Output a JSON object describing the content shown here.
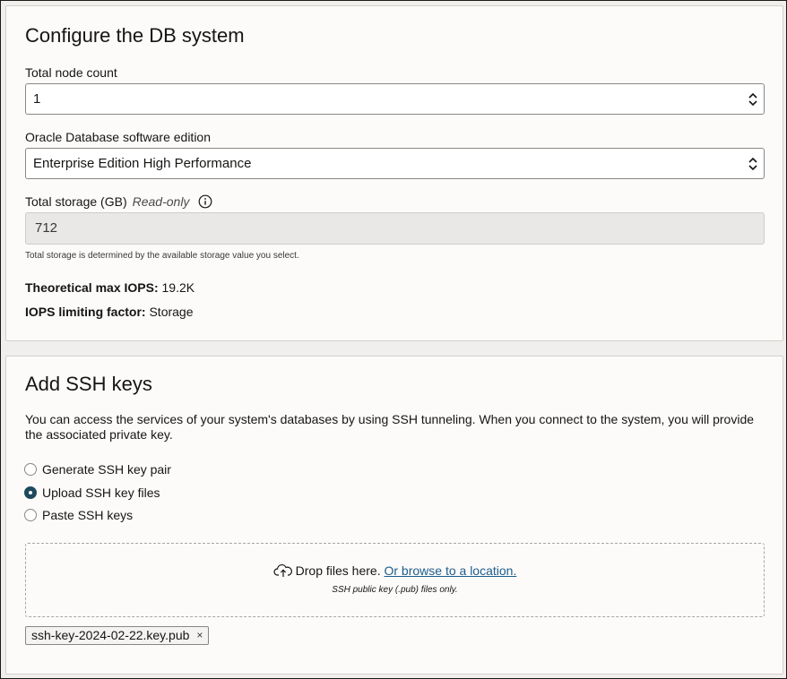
{
  "db_system": {
    "title": "Configure the DB system",
    "node_count": {
      "label": "Total node count",
      "value": "1"
    },
    "software_edition": {
      "label": "Oracle Database software edition",
      "value": "Enterprise Edition High Performance"
    },
    "storage": {
      "label": "Total storage (GB)",
      "readonly_tag": "Read-only",
      "value": "712",
      "help": "Total storage is determined by the available storage value you select."
    },
    "max_iops": {
      "label": "Theoretical max IOPS:",
      "value": "19.2K"
    },
    "iops_factor": {
      "label": "IOPS limiting factor:",
      "value": "Storage"
    }
  },
  "ssh_keys": {
    "title": "Add SSH keys",
    "description": "You can access the services of your system's databases by using SSH tunneling. When you connect to the system, you will provide the associated private key.",
    "options": [
      {
        "label": "Generate SSH key pair",
        "checked": false
      },
      {
        "label": "Upload SSH key files",
        "checked": true
      },
      {
        "label": "Paste SSH keys",
        "checked": false
      }
    ],
    "dropzone": {
      "text": "Drop files here.",
      "link": "Or browse to a location.",
      "hint": "SSH public key (.pub) files only."
    },
    "uploaded_file": "ssh-key-2024-02-22.key.pub",
    "remove_glyph": "×"
  },
  "colors": {
    "accent": "#1e4a5c",
    "link": "#1e5d8b",
    "panel_bg": "#fcfbfa",
    "page_bg": "#f1efed"
  }
}
